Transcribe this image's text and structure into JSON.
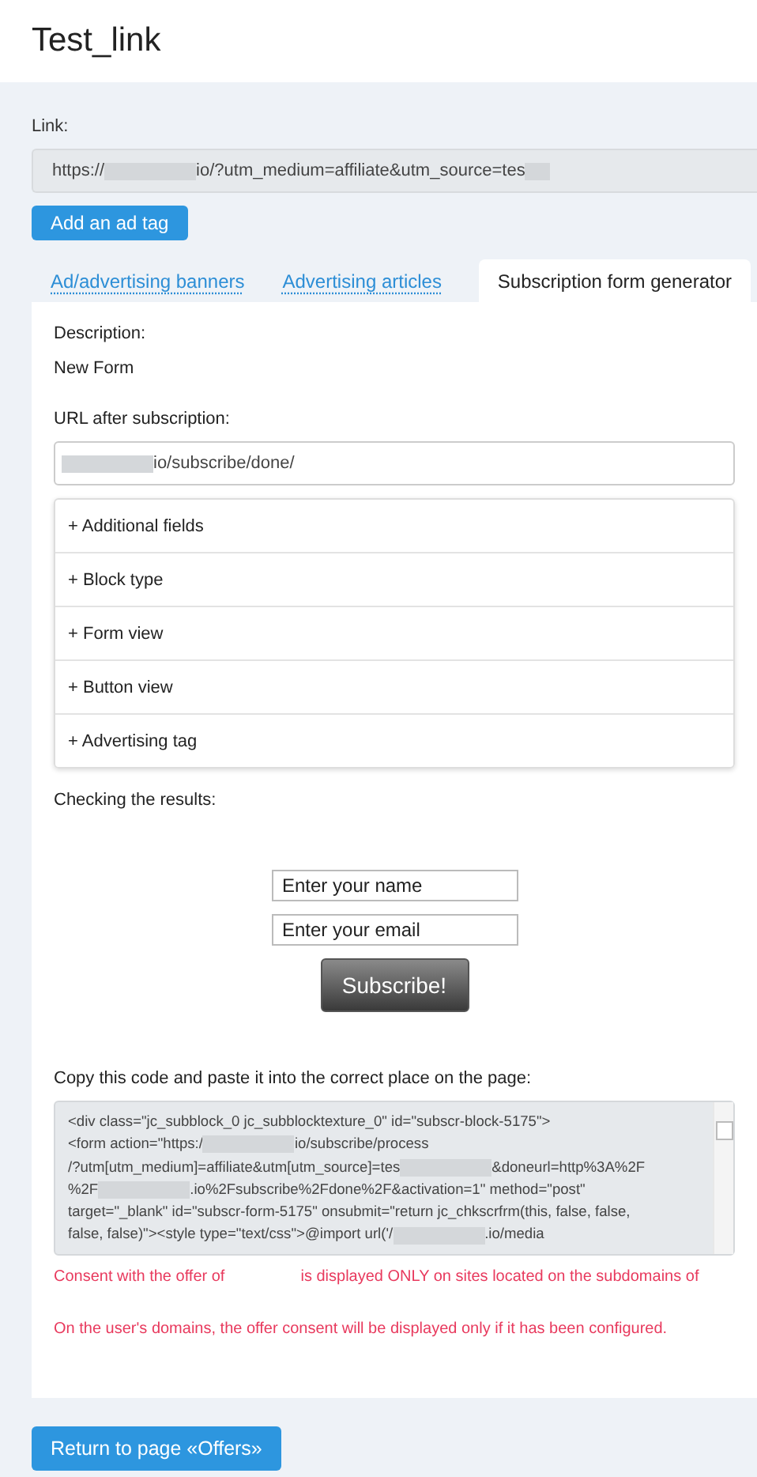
{
  "title": "Test_link",
  "link": {
    "label": "Link:",
    "value": [
      {
        "kind": "text",
        "text": "https://"
      },
      {
        "kind": "blur"
      },
      {
        "kind": "text",
        "text": "io/?utm_medium=affiliate&utm_source=tes"
      },
      {
        "kind": "blur"
      }
    ]
  },
  "add_tag_button": "Add an ad tag",
  "tabs": [
    {
      "label": "Ad/advertising banners",
      "selected": false
    },
    {
      "label": "Advertising articles",
      "selected": false
    },
    {
      "label": "Subscription form generator",
      "selected": true
    }
  ],
  "description": {
    "label": "Description:",
    "value": "New Form"
  },
  "url_after": {
    "label": "URL after subscription:",
    "value": [
      {
        "kind": "blur"
      },
      {
        "kind": "text",
        "text": "io/subscribe/done/"
      }
    ]
  },
  "sections": [
    {
      "label": "+ Additional fields"
    },
    {
      "label": "+ Block type"
    },
    {
      "label": "+ Form view"
    },
    {
      "label": "+ Button view"
    },
    {
      "label": "+ Advertising tag"
    }
  ],
  "results": {
    "label": "Checking the results:",
    "name_placeholder": "Enter your name",
    "email_placeholder": "Enter your email",
    "button": "Subscribe!"
  },
  "code": {
    "label": "Copy this code and paste it into the correct place on the page:",
    "lines": [
      [
        {
          "kind": "text",
          "text": "<div class=\"jc_subblock_0 jc_subblocktexture_0\" id=\"subscr-block-5175\">"
        }
      ],
      [
        {
          "kind": "text",
          "text": "<form action=\"https:/"
        },
        {
          "kind": "blur"
        },
        {
          "kind": "text",
          "text": "io/subscribe/process"
        }
      ],
      [
        {
          "kind": "text",
          "text": "/?utm[utm_medium]=affiliate&utm[utm_source]=tes"
        },
        {
          "kind": "blur"
        },
        {
          "kind": "text",
          "text": "&doneurl=http%3A%2F"
        }
      ],
      [
        {
          "kind": "text",
          "text": "%2F"
        },
        {
          "kind": "blur"
        },
        {
          "kind": "text",
          "text": ".io%2Fsubscribe%2Fdone%2F&activation=1\" method=\"post\""
        }
      ],
      [
        {
          "kind": "text",
          "text": "target=\"_blank\" id=\"subscr-form-5175\" onsubmit=\"return jc_chkscrfrm(this, false, false,"
        }
      ],
      [
        {
          "kind": "text",
          "text": "false, false)\"><style type=\"text/css\">@import url('/"
        },
        {
          "kind": "blur"
        },
        {
          "kind": "text",
          "text": ".io/media"
        }
      ]
    ]
  },
  "notices": [
    [
      "Consent with the offer of",
      "is displayed ONLY on sites located on the subdomains of"
    ],
    [
      "On the user's domains, the offer consent will be displayed only if it has been configured."
    ]
  ],
  "return_button": "Return to page «Offers»"
}
